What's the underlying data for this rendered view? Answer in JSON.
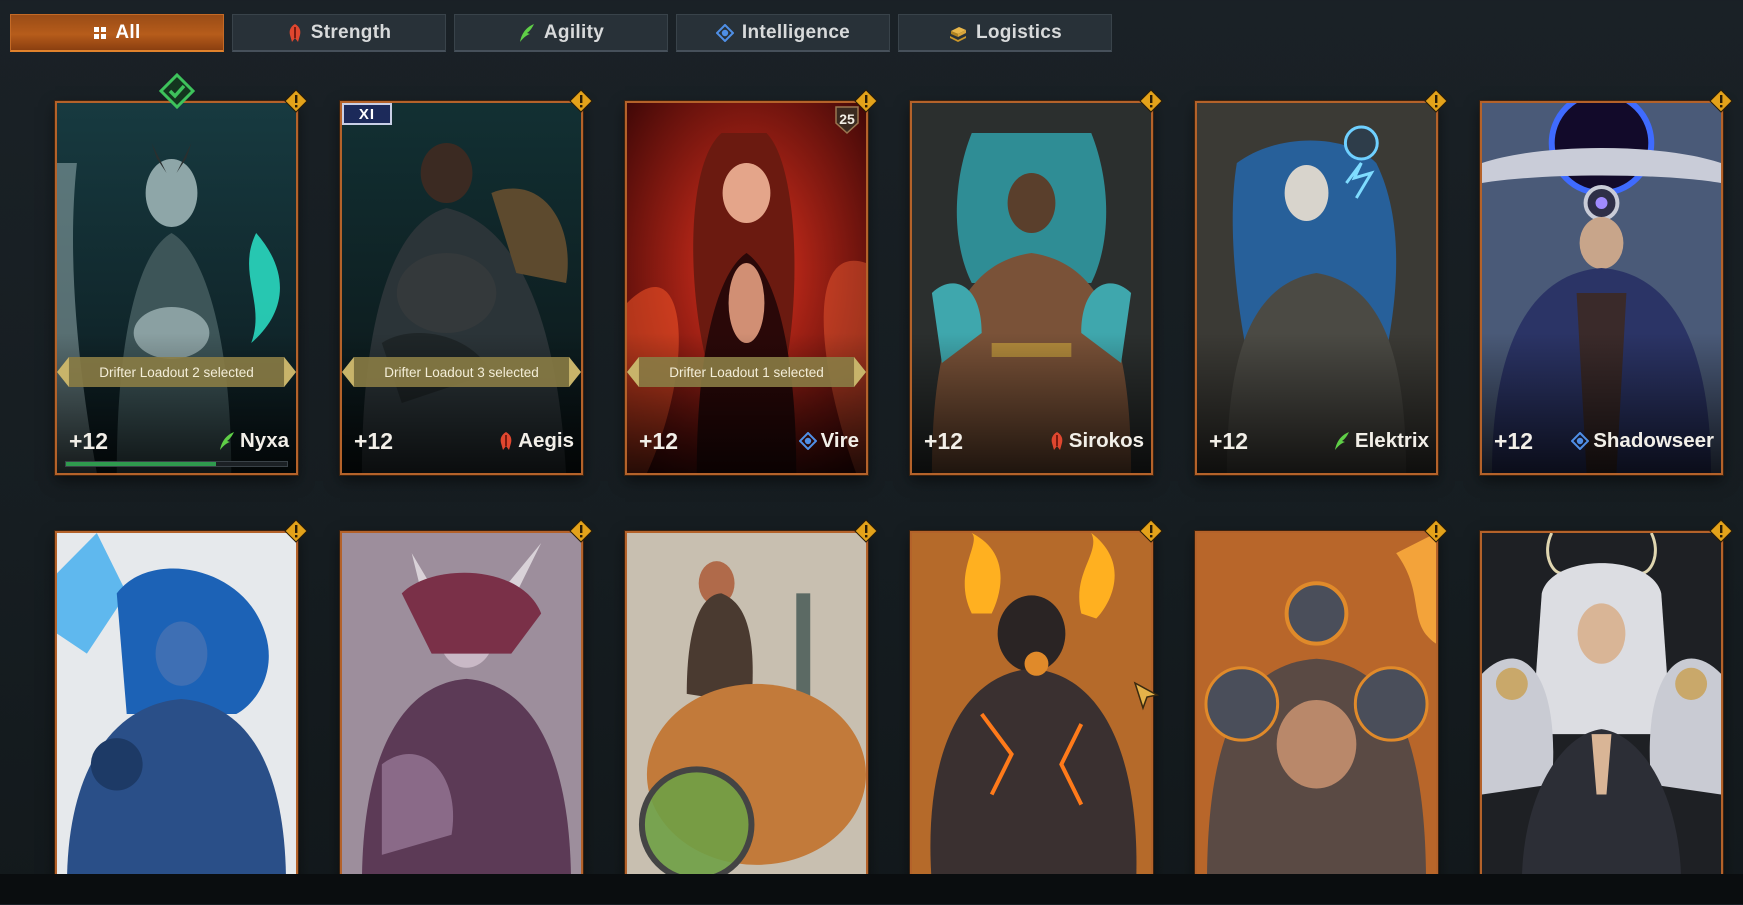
{
  "tabs": [
    {
      "label": "All",
      "icon": "grid-icon",
      "active": true
    },
    {
      "label": "Strength",
      "icon": "strength-icon",
      "active": false
    },
    {
      "label": "Agility",
      "icon": "agility-icon",
      "active": false
    },
    {
      "label": "Intelligence",
      "icon": "intelligence-icon",
      "active": false
    },
    {
      "label": "Logistics",
      "icon": "logistics-icon",
      "active": false
    }
  ],
  "row1": [
    {
      "name": "Nyxa",
      "level": "+12",
      "attribute": "agility",
      "loadout": "Drifter Loadout 2 selected",
      "badge": "check",
      "xp_progress": 0.68
    },
    {
      "name": "Aegis",
      "level": "+12",
      "attribute": "strength",
      "loadout": "Drifter Loadout 3 selected",
      "badge": "XI"
    },
    {
      "name": "Vire",
      "level": "+12",
      "attribute": "intelligence",
      "loadout": "Drifter Loadout 1 selected",
      "badge": "25"
    },
    {
      "name": "Sirokos",
      "level": "+12",
      "attribute": "strength"
    },
    {
      "name": "Elektrix",
      "level": "+12",
      "attribute": "agility"
    },
    {
      "name": "Shadowseer",
      "level": "+12",
      "attribute": "intelligence"
    }
  ],
  "colors": {
    "accent": "#b65c1b",
    "card_border": "#b4622a",
    "strength": "#e0472f",
    "agility": "#5fcf47",
    "intelligence": "#4f8fe6",
    "diamond": "#e3a21a",
    "xp": "#2f9a4e"
  }
}
